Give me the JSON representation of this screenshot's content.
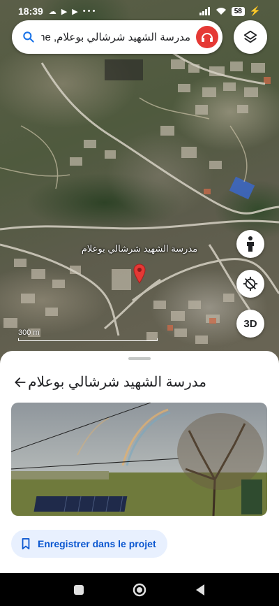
{
  "status_bar": {
    "time": "18:39",
    "battery": "58"
  },
  "search": {
    "query": "مدرسة الشهيد شرشالي بوعلام, Khe"
  },
  "map": {
    "place_label": "مدرسة الشهيد شرشالي بوعلام",
    "scale_label": "300 m",
    "three_d_label": "3D"
  },
  "sheet": {
    "title": "مدرسة الشهيد شرشالي بوعلام",
    "save_label": "Enregistrer dans le projet"
  },
  "icons": {
    "search": "search-icon",
    "avatar": "account-avatar",
    "layers": "layers-icon",
    "pin": "map-pin-icon",
    "person": "street-view-icon",
    "compass": "location-disabled-icon",
    "back": "arrow-back-icon",
    "bookmark": "bookmark-icon"
  },
  "colors": {
    "accent": "#0b57d0",
    "pin": "#e53935",
    "save_bg": "#e8f0fe"
  }
}
